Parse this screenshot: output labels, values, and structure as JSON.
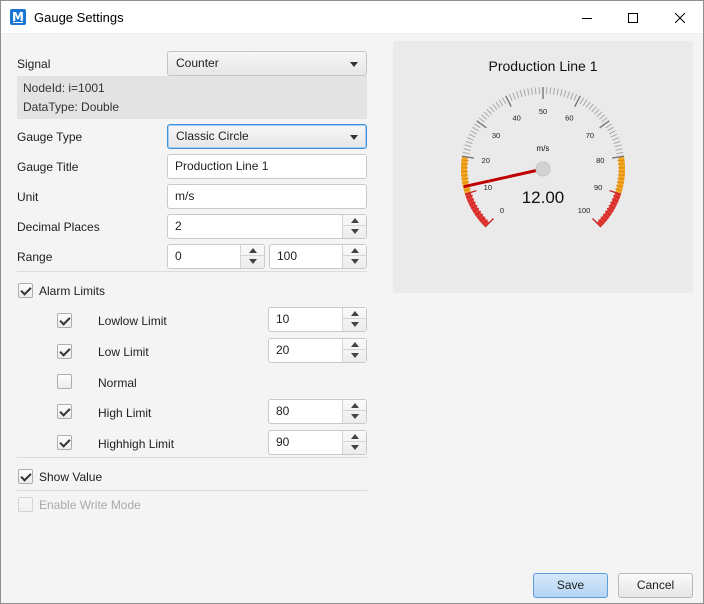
{
  "window": {
    "title": "Gauge Settings",
    "icon": "m-logo-icon"
  },
  "form": {
    "signal_label": "Signal",
    "signal_value": "Counter",
    "node_id": "NodeId: i=1001",
    "data_type": "DataType: Double",
    "gauge_type_label": "Gauge Type",
    "gauge_type_value": "Classic Circle",
    "gauge_title_label": "Gauge Title",
    "gauge_title_value": "Production Line 1",
    "unit_label": "Unit",
    "unit_value": "m/s",
    "decimal_places_label": "Decimal Places",
    "decimal_places_value": "2",
    "range_label": "Range",
    "range_min": "0",
    "range_max": "100"
  },
  "alarms": {
    "label": "Alarm Limits",
    "checked": true,
    "items": [
      {
        "label": "Lowlow Limit",
        "checked": true,
        "value": "10"
      },
      {
        "label": "Low Limit",
        "checked": true,
        "value": "20"
      },
      {
        "label": "Normal",
        "checked": false,
        "value": null
      },
      {
        "label": "High Limit",
        "checked": true,
        "value": "80"
      },
      {
        "label": "Highhigh Limit",
        "checked": true,
        "value": "90"
      }
    ]
  },
  "options": {
    "show_value_label": "Show Value",
    "show_value_checked": true,
    "write_mode_label": "Enable Write Mode",
    "write_mode_checked": false,
    "write_mode_enabled": false
  },
  "gauge": {
    "title": "Production Line 1",
    "unit": "m/s",
    "value_text": "12.00",
    "value": 12,
    "min": 0,
    "max": 100,
    "tick_labels": [
      "0",
      "10",
      "20",
      "30",
      "40",
      "50",
      "60",
      "70",
      "80",
      "90",
      "100"
    ],
    "colors": {
      "normal": "#a8a8a8",
      "warning": "#f5a623",
      "alarm": "#e53935",
      "needle": "#c00000"
    }
  },
  "buttons": {
    "save": "Save",
    "cancel": "Cancel"
  }
}
